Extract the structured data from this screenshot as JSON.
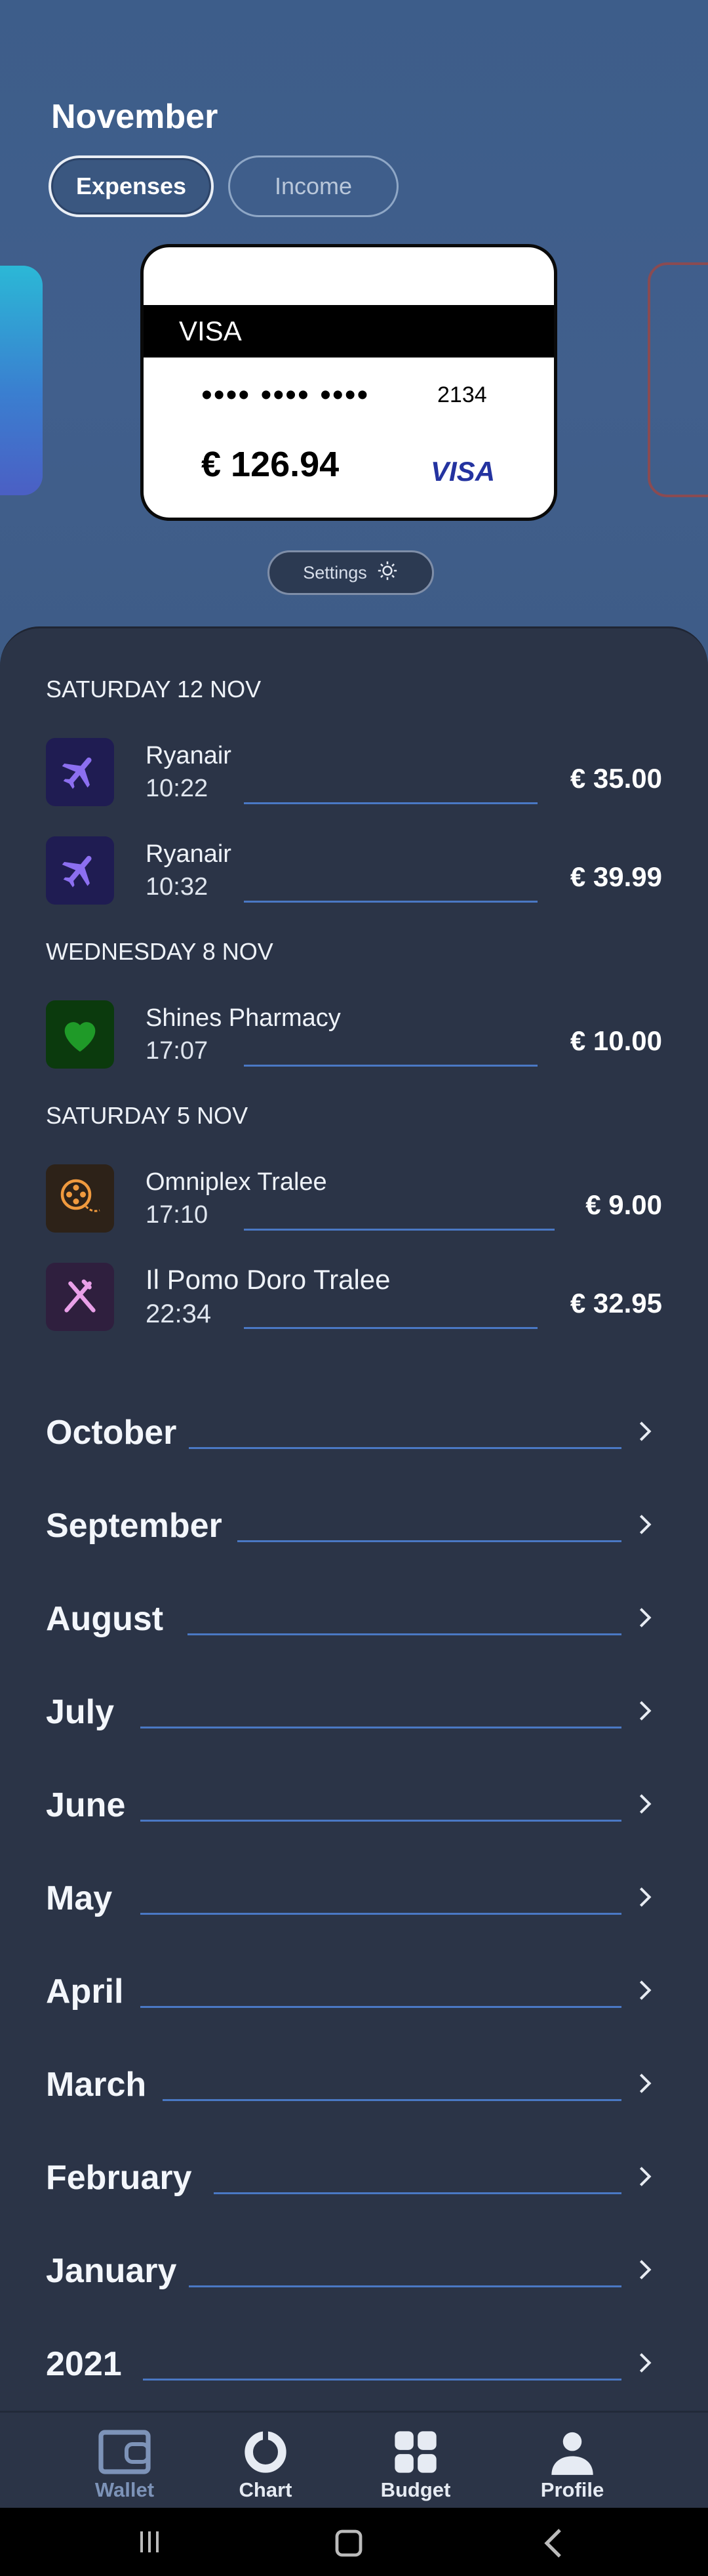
{
  "header": {
    "month": "November"
  },
  "toggle": {
    "expenses": "Expenses",
    "income": "Income"
  },
  "card": {
    "brand_band": "VISA",
    "masked": "•••• •••• ••••",
    "last4": "2134",
    "amount": "€ 126.94",
    "logo": "VISA"
  },
  "settings": {
    "label": "Settings",
    "icon": "gear-icon"
  },
  "days": [
    {
      "label": "SATURDAY 12 NOV",
      "transactions": [
        {
          "name": "Ryanair",
          "time": "10:22",
          "amount": "€ 35.00",
          "icon": "airplane-icon",
          "icon_bg": "#1f1c52",
          "icon_color": "#8c6ff0"
        },
        {
          "name": "Ryanair",
          "time": "10:32",
          "amount": "€ 39.99",
          "icon": "airplane-icon",
          "icon_bg": "#1f1c52",
          "icon_color": "#8c6ff0"
        }
      ]
    },
    {
      "label": "WEDNESDAY 8 NOV",
      "transactions": [
        {
          "name": "Shines Pharmacy",
          "time": "17:07",
          "amount": "€ 10.00",
          "icon": "heart-icon",
          "icon_bg": "#0b3a0d",
          "icon_color": "#1f9a28"
        }
      ]
    },
    {
      "label": "SATURDAY 5 NOV",
      "transactions": [
        {
          "name": "Omniplex Tralee",
          "time": "17:10",
          "amount": "€ 9.00",
          "icon": "film-reel-icon",
          "icon_bg": "#2d2218",
          "icon_color": "#f09a3e"
        },
        {
          "name": "Il Pomo Doro Tralee",
          "time": "22:34",
          "amount": "€ 32.95",
          "icon": "cutlery-icon",
          "icon_bg": "#2f1f3e",
          "icon_color": "#e9a0e8"
        }
      ]
    }
  ],
  "months": [
    "October",
    "September",
    "August",
    "July",
    "June",
    "May",
    "April",
    "March",
    "February",
    "January",
    "2021"
  ],
  "nav": [
    {
      "label": "Wallet",
      "icon": "wallet-icon",
      "active": true
    },
    {
      "label": "Chart",
      "icon": "pie-chart-icon",
      "active": false
    },
    {
      "label": "Budget",
      "icon": "grid-icon",
      "active": false
    },
    {
      "label": "Profile",
      "icon": "user-icon",
      "active": false
    }
  ],
  "colors": {
    "accent_line": "#4a78c4",
    "sheet": "#2b3447",
    "background": "#3e5f8a"
  }
}
